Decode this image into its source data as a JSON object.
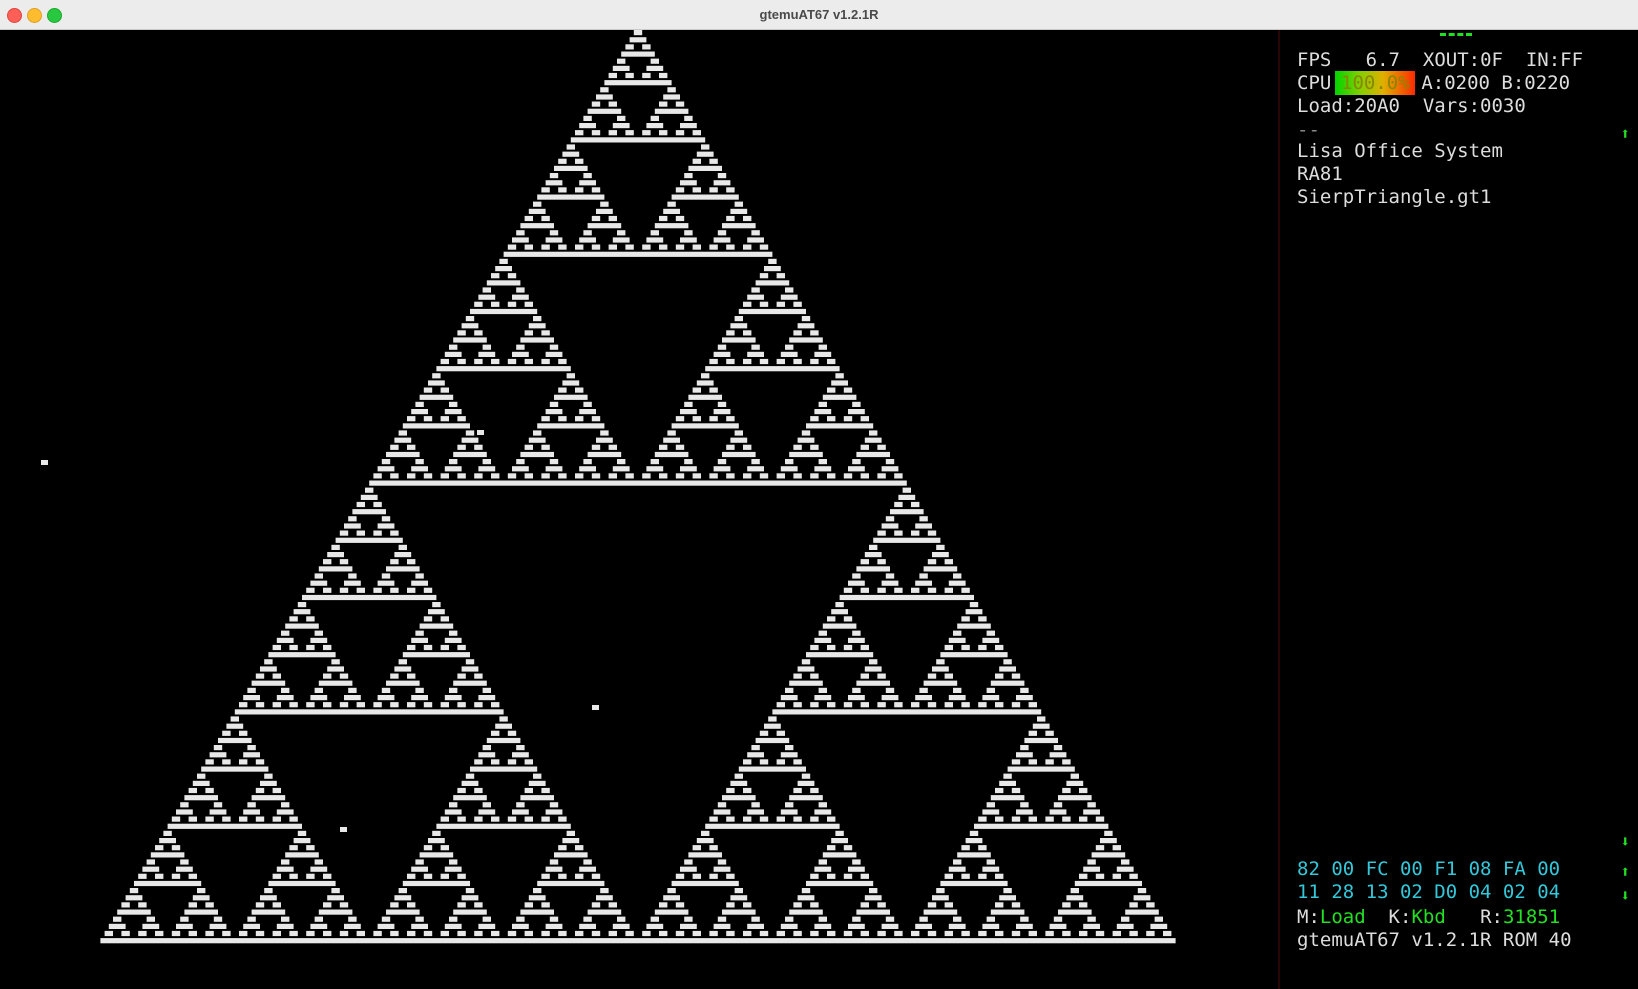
{
  "window": {
    "title": "gtemuAT67 v1.2.1R"
  },
  "stats": {
    "fps_label": "FPS",
    "fps_value": "6.7",
    "xout": "XOUT:0F",
    "in": "IN:FF",
    "cpu_label": "CPU",
    "cpu_value": "100.0%",
    "a": "A:0200",
    "b": "B:0220",
    "load": "Load:20A0",
    "vars": "Vars:0030"
  },
  "file_list": {
    "parent": "--",
    "items": [
      "Lisa Office System",
      "RA81",
      "SierpTriangle.gt1"
    ]
  },
  "memory": {
    "row1": "82 00 FC 00 F1 08 FA 00",
    "row2": "11 28 13 02 D0 04 02 04"
  },
  "status": {
    "mode_label": "M:",
    "mode_value": "Load",
    "key_label": "K:",
    "key_value": "Kbd",
    "r_label": "R:",
    "r_value": "31851",
    "rom": "gtemuAT67 v1.2.1R ROM 40"
  },
  "colors": {
    "cyan": "#33c7d9",
    "green": "#22e022",
    "text": "#dddddd"
  },
  "icons": [
    "scroll-up-icon",
    "scroll-down-icon"
  ]
}
